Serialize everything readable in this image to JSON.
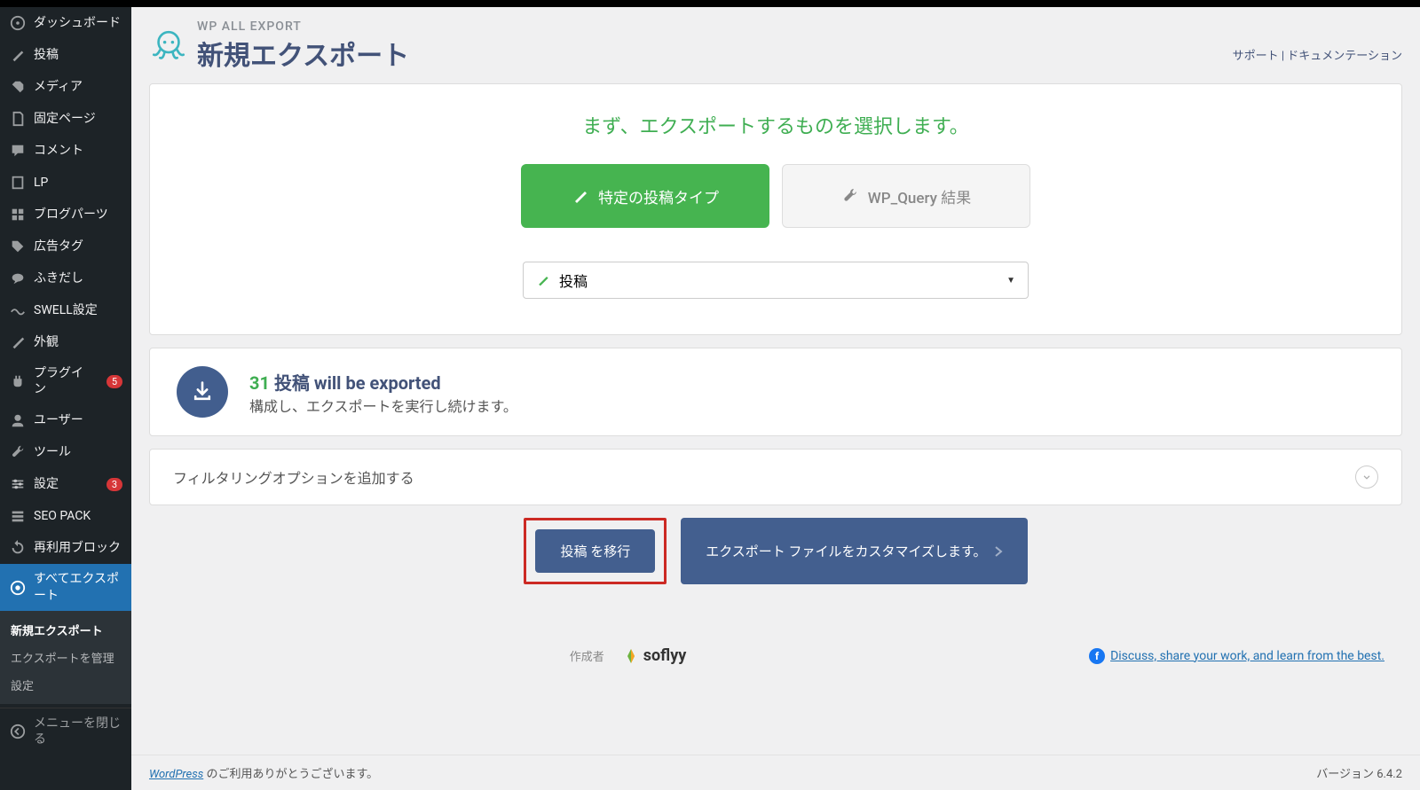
{
  "sidebar": {
    "items": [
      {
        "label": "ダッシュボード",
        "icon": "dashboard"
      },
      {
        "label": "投稿",
        "icon": "pin"
      },
      {
        "label": "メディア",
        "icon": "media"
      },
      {
        "label": "固定ページ",
        "icon": "page"
      },
      {
        "label": "コメント",
        "icon": "comment"
      },
      {
        "label": "LP",
        "icon": "page"
      },
      {
        "label": "ブログパーツ",
        "icon": "grid"
      },
      {
        "label": "広告タグ",
        "icon": "tag"
      },
      {
        "label": "ふきだし",
        "icon": "bubble"
      },
      {
        "label": "SWELL設定",
        "icon": "swell"
      },
      {
        "label": "外観",
        "icon": "brush"
      },
      {
        "label": "プラグイン",
        "icon": "plugin",
        "badge": "5"
      },
      {
        "label": "ユーザー",
        "icon": "user"
      },
      {
        "label": "ツール",
        "icon": "tool"
      },
      {
        "label": "設定",
        "icon": "settings",
        "badge": "3"
      },
      {
        "label": "SEO PACK",
        "icon": "seo"
      },
      {
        "label": "再利用ブロック",
        "icon": "reuse"
      },
      {
        "label": "すべてエクスポート",
        "icon": "export",
        "active": true
      }
    ],
    "sub": [
      {
        "label": "新規エクスポート",
        "current": true
      },
      {
        "label": "エクスポートを管理"
      },
      {
        "label": "設定"
      }
    ],
    "collapse": "メニューを閉じる"
  },
  "header": {
    "suptitle": "WP ALL EXPORT",
    "title": "新規エクスポート",
    "links": {
      "support": "サポート",
      "sep": " | ",
      "docs": "ドキュメンテーション"
    }
  },
  "step1": {
    "heading": "まず、エクスポートするものを選択します。",
    "tab_specific": "特定の投稿タイプ",
    "tab_wpquery": "WP_Query 結果",
    "selected_posttype": "投稿"
  },
  "stats": {
    "count": "31",
    "label_post": "投稿",
    "label_suffix": " will be exported",
    "line2": "構成し、エクスポートを実行し続けます。"
  },
  "filter": {
    "title": "フィルタリングオプションを追加する"
  },
  "actions": {
    "migrate": "投稿 を移行",
    "customize": "エクスポート ファイルをカスタマイズします。"
  },
  "footer": {
    "author_label": "作成者",
    "brand": "soflyy",
    "fb_text": "Discuss, share your work, and learn from the best."
  },
  "bottom": {
    "wp_link": "WordPress",
    "thanks": " のご利用ありがとうございます。",
    "version": "バージョン 6.4.2"
  }
}
